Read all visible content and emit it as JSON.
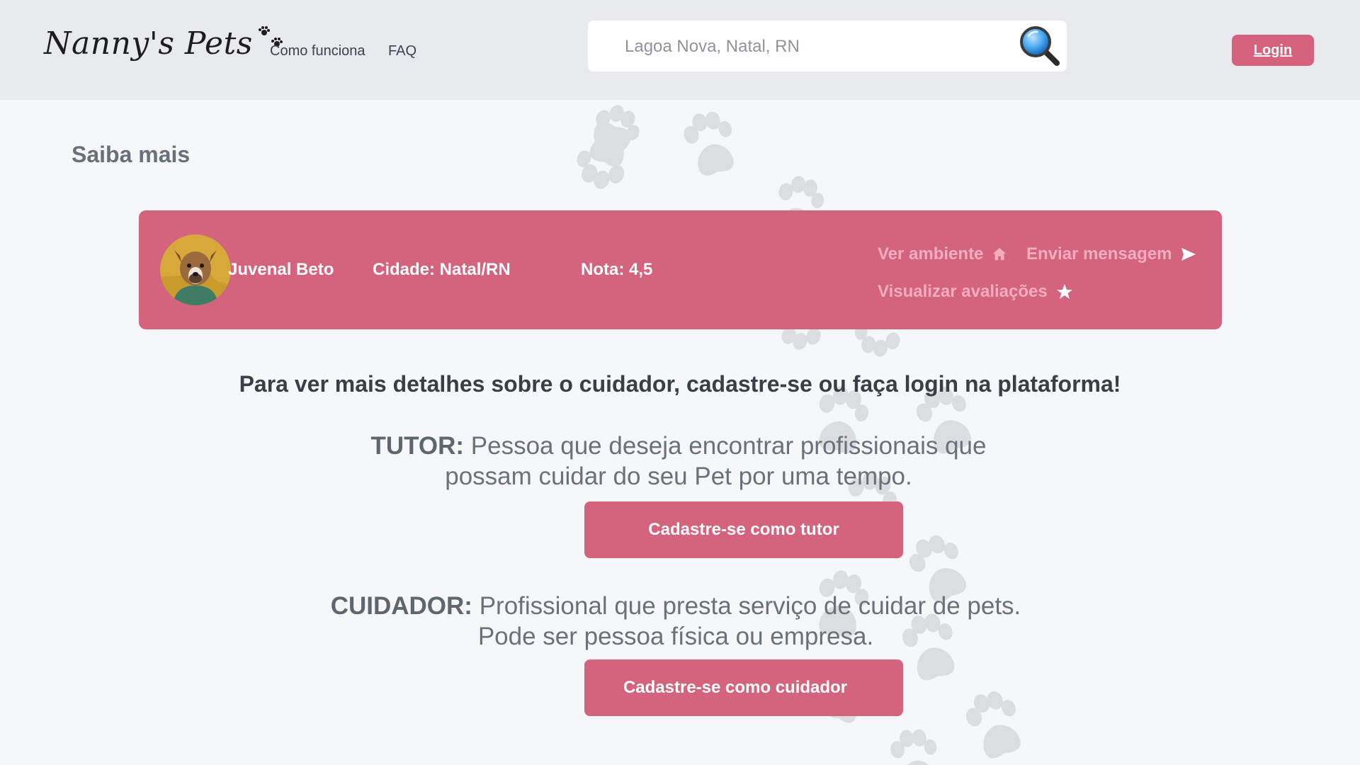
{
  "header": {
    "logo_text": "Nanny's Pets",
    "nav": [
      {
        "label": "Como funciona"
      },
      {
        "label": "FAQ"
      }
    ],
    "search": {
      "placeholder": "Lagoa Nova, Natal, RN",
      "icon": "search-icon"
    },
    "login_label": "Login"
  },
  "main": {
    "section_title": "Saiba mais",
    "caregiver": {
      "name": "Juvenal Beto",
      "city": "Cidade: Natal/RN",
      "rating": "Nota: 4,5",
      "actions": {
        "view_environment": "Ver ambiente",
        "send_message": "Enviar mensagem",
        "view_reviews": "Visualizar avaliações"
      }
    },
    "cta_text": "Para ver mais detalhes sobre o cuidador, cadastre-se ou faça login  na plataforma!",
    "tutor": {
      "title": "TUTOR:",
      "line1": " Pessoa que deseja encontrar profissionais que",
      "line2": "possam cuidar do seu Pet por uma tempo.",
      "button_label": "Cadastre-se como tutor"
    },
    "cuidador": {
      "title": "CUIDADOR:",
      "line1": " Profissional que presta serviço de cuidar de pets.",
      "line2": "Pode ser pessoa física ou empresa.",
      "button_label": "Cadastre-se como cuidador"
    }
  },
  "colors": {
    "accent": "#d4637e",
    "header_bg": "#e8eaed",
    "page_bg": "#f6f7f9",
    "action_text": "#f2aebd"
  }
}
